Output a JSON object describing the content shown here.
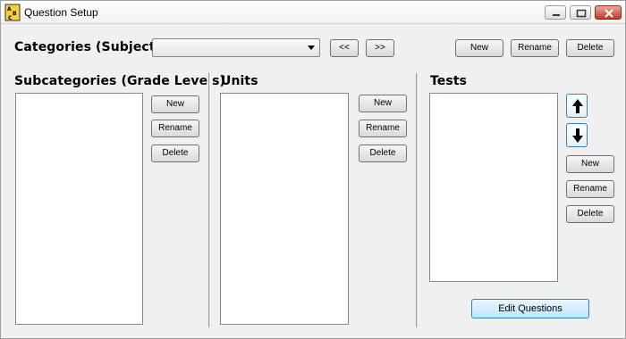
{
  "window": {
    "title": "Question Setup",
    "icon": "abc-app-icon",
    "controls": {
      "minimize": "minimize-icon",
      "maximize": "maximize-icon",
      "close": "close-icon"
    }
  },
  "categories": {
    "label": "Categories (Subjects)",
    "selected": "",
    "prev_label": "<<",
    "next_label": ">>",
    "new_label": "New",
    "rename_label": "Rename",
    "delete_label": "Delete"
  },
  "subcategories": {
    "label": "Subcategories (Grade Levels)",
    "items": [],
    "new_label": "New",
    "rename_label": "Rename",
    "delete_label": "Delete"
  },
  "units": {
    "label": "Units",
    "items": [],
    "new_label": "New",
    "rename_label": "Rename",
    "delete_label": "Delete"
  },
  "tests": {
    "label": "Tests",
    "items": [],
    "move_up_icon": "arrow-up-icon",
    "move_down_icon": "arrow-down-icon",
    "new_label": "New",
    "rename_label": "Rename",
    "delete_label": "Delete"
  },
  "edit_questions_label": "Edit Questions"
}
